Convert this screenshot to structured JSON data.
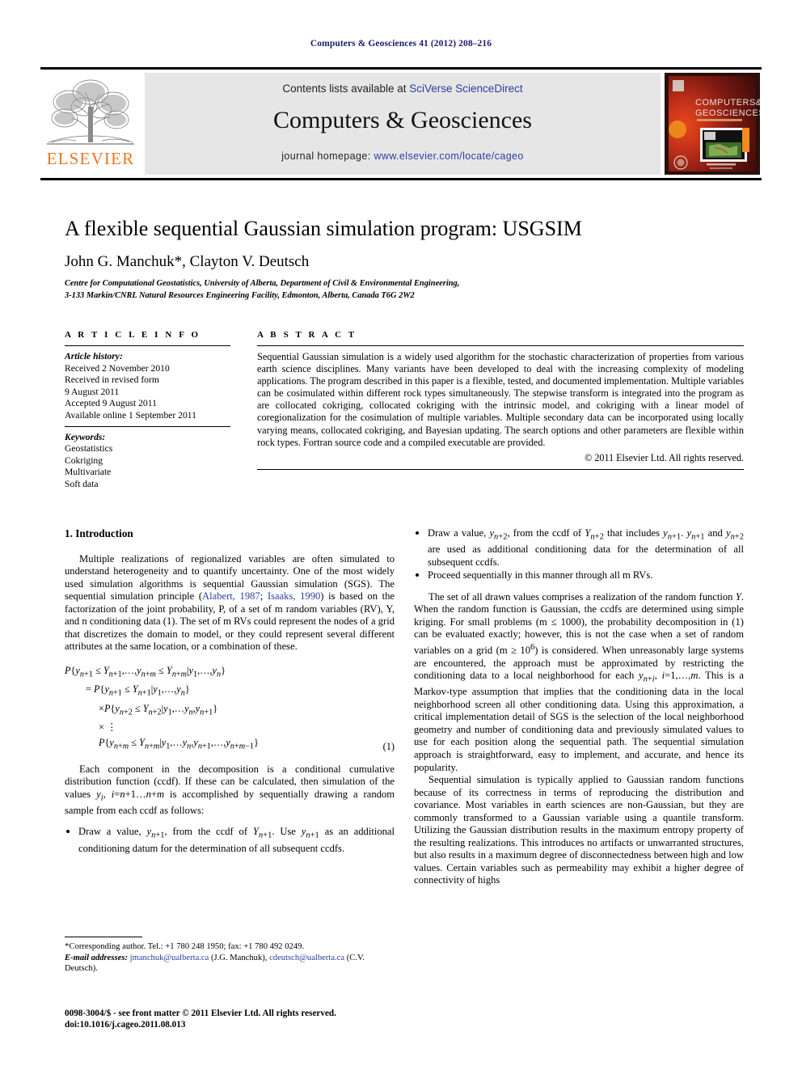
{
  "running_head": "Computers & Geosciences 41 (2012) 208–216",
  "masthead": {
    "contents_prefix": "Contents lists available at ",
    "contents_link": "SciVerse ScienceDirect",
    "journal_title": "Computers & Geosciences",
    "homepage_prefix": "journal homepage: ",
    "homepage_url": "www.elsevier.com/locate/cageo",
    "publisher_wordmark": "ELSEVIER",
    "publisher_color": "#E87722",
    "link_color": "#2b3ea0",
    "band_color": "#e6e6e6",
    "cover_title_line1": "COMPUTERS &",
    "cover_title_line2": "GEOSCIENCES"
  },
  "article": {
    "title": "A flexible sequential Gaussian simulation program: USGSIM",
    "authors": "John G. Manchuk*, Clayton V. Deutsch",
    "affiliation_line1": "Centre for Computational Geostatistics, University of Alberta, Department of Civil & Environmental Engineering,",
    "affiliation_line2": "3-133 Markin/CNRL Natural Resources Engineering Facility, Edmonton, Alberta, Canada T6G 2W2"
  },
  "article_info": {
    "heading": "A R T I C L E   I N F O",
    "history_label": "Article history:",
    "history": [
      "Received 2 November 2010",
      "Received in revised form",
      "9 August 2011",
      "Accepted 9 August 2011",
      "Available online 1 September 2011"
    ],
    "keywords_label": "Keywords:",
    "keywords": [
      "Geostatistics",
      "Cokriging",
      "Multivariate",
      "Soft data"
    ]
  },
  "abstract": {
    "heading": "A B S T R A C T",
    "text": "Sequential Gaussian simulation is a widely used algorithm for the stochastic characterization of properties from various earth science disciplines. Many variants have been developed to deal with the increasing complexity of modeling applications. The program described in this paper is a flexible, tested, and documented implementation. Multiple variables can be cosimulated within different rock types simultaneously. The stepwise transform is integrated into the program as are collocated cokriging, collocated cokriging with the intrinsic model, and cokriging with a linear model of coregionalization for the cosimulation of multiple variables. Multiple secondary data can be incorporated using locally varying means, collocated cokriging, and Bayesian updating. The search options and other parameters are flexible within rock types. Fortran source code and a compiled executable are provided.",
    "copyright": "© 2011 Elsevier Ltd. All rights reserved."
  },
  "body": {
    "section1_heading": "1.  Introduction",
    "left": {
      "para1_a": "Multiple realizations of regionalized variables are often simulated to understand heterogeneity and to quantify uncertainty. One of the most widely used simulation algorithms is sequential Gaussian simulation (SGS). The sequential simulation principle (",
      "cite1": "Alabert, 1987",
      "cite_sep": "; ",
      "cite2": "Isaaks, 1990",
      "para1_b": ") is based on the factorization of the joint probability, P, of a set of m random variables (RV), Y, and n conditioning data (1). The set of m RVs could represent the nodes of a grid that discretizes the domain to model, or they could represent several different attributes at the same location, or a combination of these.",
      "equation": {
        "line1": "P{y_{n+1} ≤ Y_{n+1},…,y_{n+m} ≤ Y_{n+m}|y_1,…,y_n}",
        "line2": "= P{y_{n+1} ≤ Y_{n+1}|y_1,…,y_n}",
        "line3": "×P{y_{n+2} ≤ Y_{n+2}|y_1,…,y_n,y_{n+1}}",
        "line4": "× :",
        "line5": "P{y_{n+m} ≤ Y_{n+m}|y_1,…,y_n,y_{n+1},…,y_{n+m−1}}",
        "number": "(1)"
      },
      "para2": "Each component in the decomposition is a conditional cumulative distribution function (ccdf). If these can be calculated, then simulation of the values y_i, i=n+1…n+m is accomplished by sequentially drawing a random sample from each ccdf as follows:",
      "bullet1": "Draw a value, y_{n+1}, from the ccdf of Y_{n+1}. Use y_{n+1} as an additional conditioning datum for the determination of all subsequent ccdfs."
    },
    "right": {
      "bullet2": "Draw a value, y_{n+2}, from the ccdf of Y_{n+2} that includes y_{n+1}. y_{n+1} and y_{n+2} are used as additional conditioning data for the determination of all subsequent ccdfs.",
      "bullet3": "Proceed sequentially in this manner through all m RVs.",
      "para3": "The set of all drawn values comprises a realization of the random function Y. When the random function is Gaussian, the ccdfs are determined using simple kriging. For small problems (m ≤ 1000), the probability decomposition in (1) can be evaluated exactly; however, this is not the case when a set of random variables on a grid (m ≥ 10⁶) is considered. When unreasonably large systems are encountered, the approach must be approximated by restricting the conditioning data to a local neighborhood for each y_{n+i}, i=1,…,m. This is a Markov-type assumption that implies that the conditioning data in the local neighborhood screen all other conditioning data. Using this approximation, a critical implementation detail of SGS is the selection of the local neighborhood geometry and number of conditioning data and previously simulated values to use for each position along the sequential path. The sequential simulation approach is straightforward, easy to implement, and accurate, and hence its popularity.",
      "para4": "Sequential simulation is typically applied to Gaussian random functions because of its correctness in terms of reproducing the distribution and covariance. Most variables in earth sciences are non-Gaussian, but they are commonly transformed to a Gaussian variable using a quantile transform. Utilizing the Gaussian distribution results in the maximum entropy property of the resulting realizations. This introduces no artifacts or unwarranted structures, but also results in a maximum degree of disconnectedness between high and low values. Certain variables such as permeability may exhibit a higher degree of connectivity of highs"
    }
  },
  "footnote": {
    "corresponding": "Corresponding author. Tel.: +1 780 248 1950; fax: +1 780 492 0249.",
    "email_label": "E-mail addresses:",
    "email1": "jmanchuk@ualberta.ca",
    "email1_owner": " (J.G. Manchuk),",
    "email2": "cdeutsch@ualberta.ca",
    "email2_owner": " (C.V. Deutsch)."
  },
  "footer": {
    "issn_line": "0098-3004/$ - see front matter © 2011 Elsevier Ltd. All rights reserved.",
    "doi_line": "doi:10.1016/j.cageo.2011.08.013"
  }
}
